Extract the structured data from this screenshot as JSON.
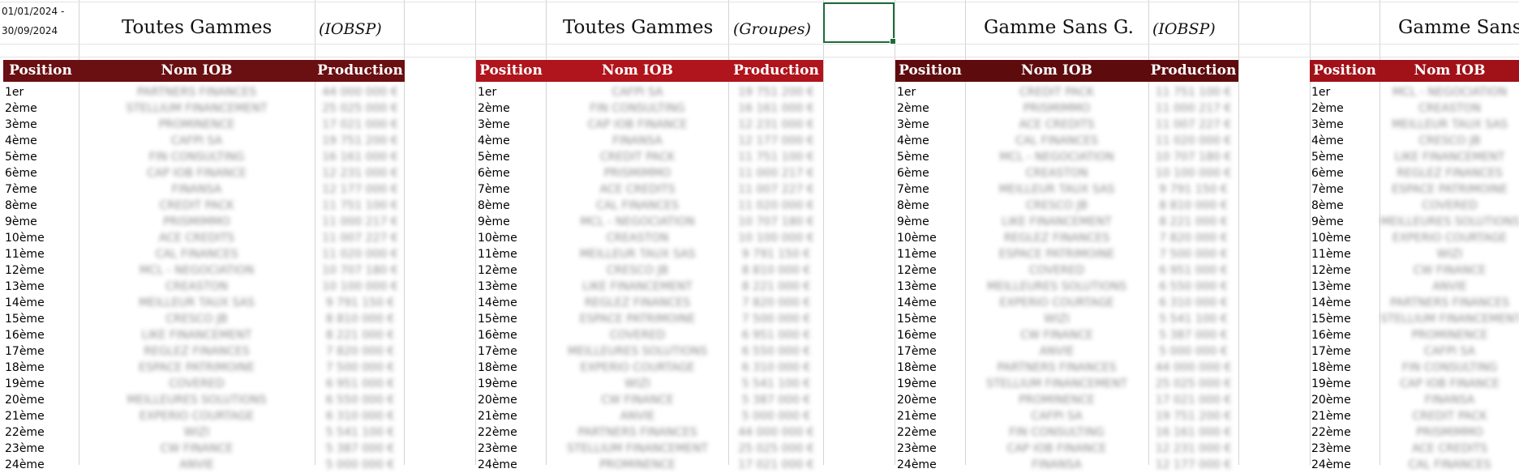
{
  "header": {
    "date_range_start": "01/01/2024 -",
    "date_range_end": "30/09/2024",
    "blocks": [
      {
        "title": "Toutes Gammes",
        "subtitle": "(IOBSP)"
      },
      {
        "title": "Toutes Gammes",
        "subtitle": "(Groupes)"
      },
      {
        "title": "Gamme Sans G.",
        "subtitle": "(IOBSP)"
      },
      {
        "title": "Gamme Sans",
        "subtitle": ""
      }
    ]
  },
  "columns": {
    "position": "Position",
    "nom_iob": "Nom IOB",
    "production": "Production"
  },
  "colors": {
    "table1_header": "#6a0f12",
    "table2_header": "#b0141c",
    "table3_header": "#5e0b0e",
    "table4_header": "#a01218",
    "selection": "#1e6b3a"
  },
  "positions": [
    "1er",
    "2ème",
    "3ème",
    "4ème",
    "5ème",
    "6ème",
    "7ème",
    "8ème",
    "9ème",
    "10ème",
    "11ème",
    "12ème",
    "13ème",
    "14ème",
    "15ème",
    "16ème",
    "17ème",
    "18ème",
    "19ème",
    "20ème",
    "21ème",
    "22ème",
    "23ème",
    "24ème"
  ],
  "blurred_names": [
    "PARTNERS FINANCES",
    "STELLIUM FINANCEMENT",
    "PROMINENCE",
    "CAFPI SA",
    "FIN CONSULTING",
    "CAP IOB FINANCE",
    "FINANSA",
    "CREDIT PACK",
    "PRISMIMMO",
    "ACE CREDITS",
    "CAL FINANCES",
    "MCL - NEGOCIATION",
    "CREASTON",
    "MEILLEUR TAUX SAS",
    "CRESCO JB",
    "LIKE FINANCEMENT",
    "REGLEZ FINANCES",
    "ESPACE PATRIMOINE",
    "COVERED",
    "MEILLEURES SOLUTIONS",
    "EXPERIO COURTAGE",
    "WIZI",
    "CW FINANCE",
    "ANVIE"
  ],
  "blurred_amounts": [
    "44 000 000 €",
    "25 025 000 €",
    "17 021 000 €",
    "19 751 200 €",
    "16 161 000 €",
    "12 231 000 €",
    "12 177 000 €",
    "11 751 100 €",
    "11 000 217 €",
    "11 007 227 €",
    "11 020 000 €",
    "10 707 180 €",
    "10 100 000 €",
    "9 791 150 €",
    "8 810 000 €",
    "8 221 000 €",
    "7 820 000 €",
    "7 500 000 €",
    "6 951 000 €",
    "6 550 000 €",
    "6 310 000 €",
    "5 541 100 €",
    "5 387 000 €",
    "5 000 000 €"
  ]
}
